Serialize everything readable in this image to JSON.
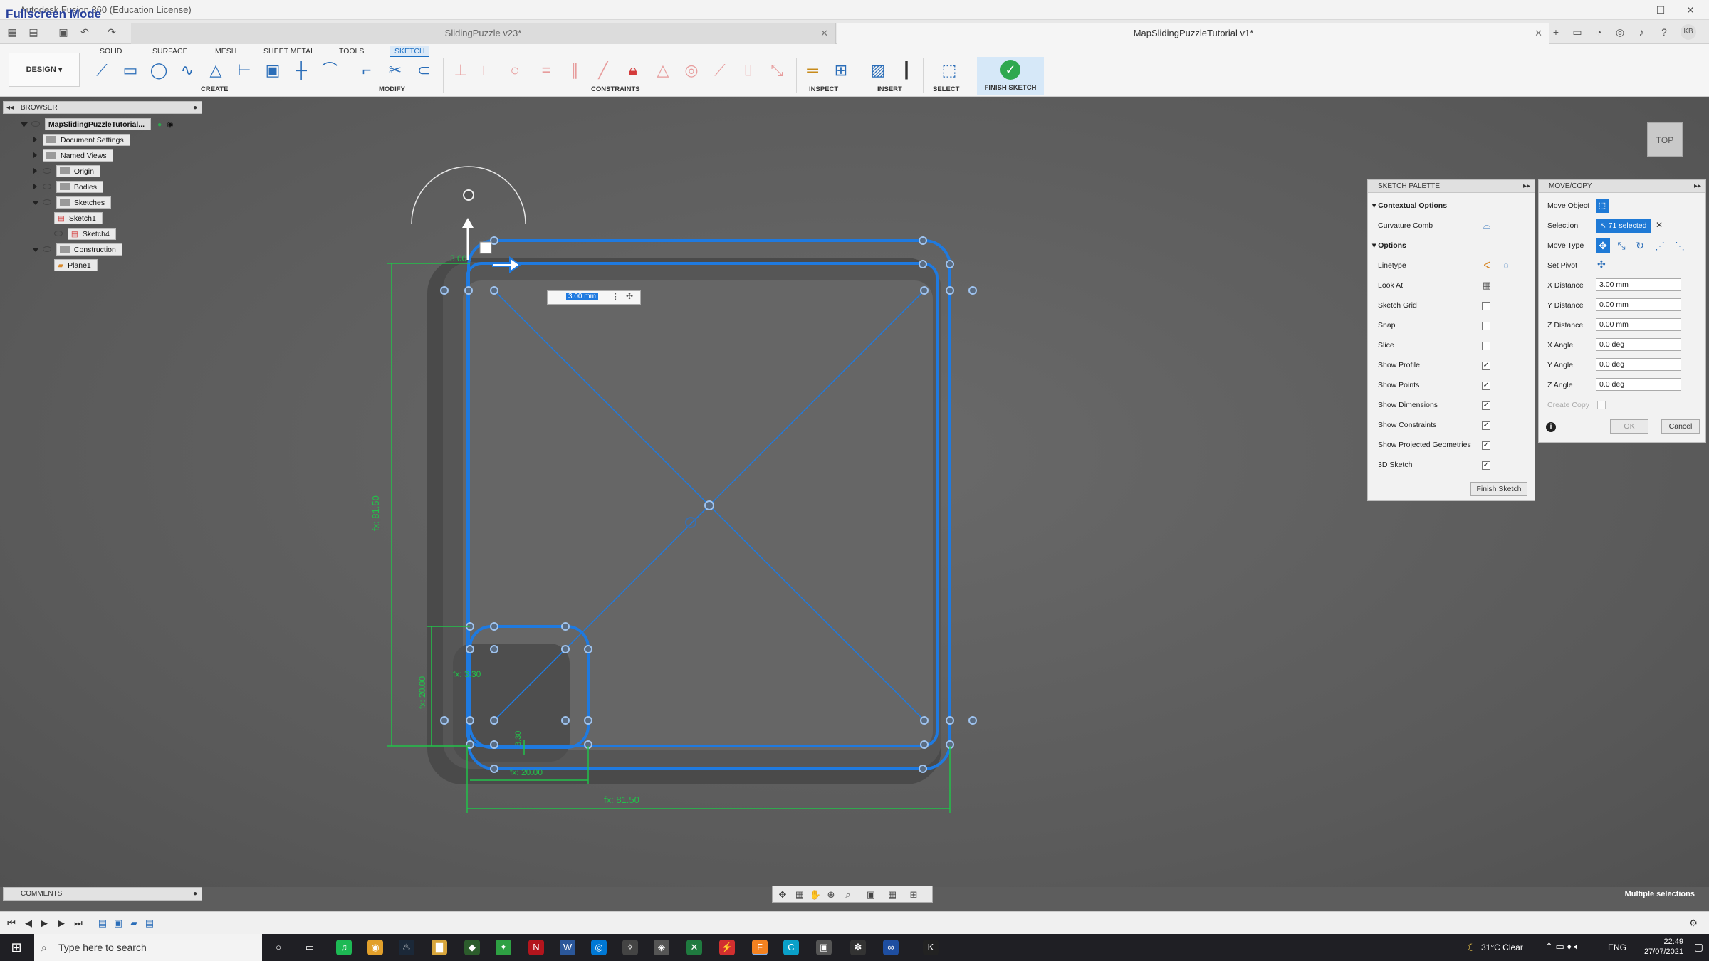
{
  "window": {
    "title": "Autodesk Fusion 360 (Education License)",
    "fullscreen_label": "Fullscreen Mode",
    "doc_tab_1": "SlidingPuzzle v23*",
    "doc_tab_2": "MapSlidingPuzzleTutorial v1*",
    "user_initials": "KB"
  },
  "ribbon": {
    "workspace": "DESIGN",
    "tabs": [
      "SOLID",
      "SURFACE",
      "MESH",
      "SHEET METAL",
      "TOOLS",
      "SKETCH"
    ],
    "active_tab": "SKETCH",
    "groups": {
      "create": "CREATE",
      "modify": "MODIFY",
      "constraints": "CONSTRAINTS",
      "inspect": "INSPECT",
      "insert": "INSERT",
      "select": "SELECT",
      "finish": "FINISH SKETCH"
    }
  },
  "browser": {
    "title": "BROWSER",
    "root": "MapSlidingPuzzleTutorial...",
    "items": [
      {
        "label": "Document Settings"
      },
      {
        "label": "Named Views"
      },
      {
        "label": "Origin"
      },
      {
        "label": "Bodies"
      },
      {
        "label": "Sketches"
      },
      {
        "label": "Sketch1"
      },
      {
        "label": "Sketch4"
      },
      {
        "label": "Construction"
      },
      {
        "label": "Plane1"
      }
    ]
  },
  "canvas": {
    "dim_inline_value": "3.00 mm",
    "dim_label_top": "3.00",
    "dim_vertical": "fx: 81.50",
    "dim_horizontal": "fx: 81.50",
    "dim_small_vertical": "fx: 20.00",
    "dim_small_horizontal": "fx: 20.00",
    "dim_small_inner": "fx: 3.30",
    "dim_small_inner2": "3.30"
  },
  "sketch_palette": {
    "title": "SKETCH PALETTE",
    "contextual_options": "Contextual Options",
    "curvature_comb": "Curvature Comb",
    "options": "Options",
    "rows": [
      {
        "label": "Linetype",
        "type": "icon"
      },
      {
        "label": "Look At",
        "type": "icon"
      },
      {
        "label": "Sketch Grid",
        "checked": false
      },
      {
        "label": "Snap",
        "checked": false
      },
      {
        "label": "Slice",
        "checked": false
      },
      {
        "label": "Show Profile",
        "checked": true
      },
      {
        "label": "Show Points",
        "checked": true
      },
      {
        "label": "Show Dimensions",
        "checked": true
      },
      {
        "label": "Show Constraints",
        "checked": true
      },
      {
        "label": "Show Projected Geometries",
        "checked": true
      },
      {
        "label": "3D Sketch",
        "checked": true
      }
    ],
    "finish_button": "Finish Sketch"
  },
  "move_copy": {
    "title": "MOVE/COPY",
    "move_object": "Move Object",
    "selection": "Selection",
    "selection_value": "71 selected",
    "move_type": "Move Type",
    "set_pivot": "Set Pivot",
    "x_distance_label": "X Distance",
    "x_distance": "3.00 mm",
    "y_distance_label": "Y Distance",
    "y_distance": "0.00 mm",
    "z_distance_label": "Z Distance",
    "z_distance": "0.00 mm",
    "x_angle_label": "X Angle",
    "x_angle": "0.0 deg",
    "y_angle_label": "Y Angle",
    "y_angle": "0.0 deg",
    "z_angle_label": "Z Angle",
    "z_angle": "0.0 deg",
    "create_copy": "Create Copy",
    "ok": "OK",
    "cancel": "Cancel"
  },
  "bottom": {
    "comments": "COMMENTS",
    "status": "Multiple selections"
  },
  "viewcube": {
    "face": "TOP"
  },
  "taskbar": {
    "search_placeholder": "Type here to search",
    "weather": "31°C  Clear",
    "lang": "ENG",
    "time": "22:49",
    "date": "27/07/2021"
  },
  "colors": {
    "sketch_blue": "#1f7ae0",
    "dimension_green": "#22c24a",
    "accent": "#1a6fc4",
    "finish_green": "#2fa84f"
  }
}
